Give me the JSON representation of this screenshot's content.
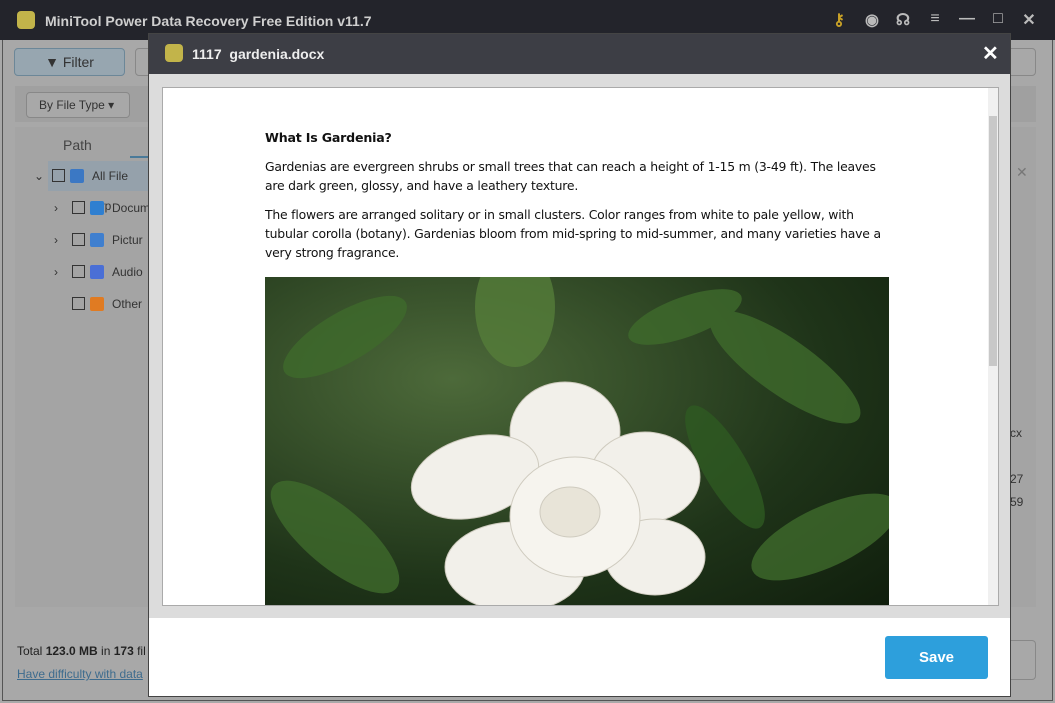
{
  "window": {
    "title": "MiniTool Power Data Recovery Free Edition v11.7",
    "icons": [
      "key-icon",
      "disc-icon",
      "headset-icon",
      "menu-icon",
      "minimize-icon",
      "maximize-icon",
      "close-icon"
    ]
  },
  "toolbar": {
    "filter_label": "Filter",
    "by_file_type": "By File Type"
  },
  "tree": {
    "header": "Path",
    "items": [
      {
        "label": "All File Typ",
        "color": "#3b78c4"
      },
      {
        "label": "Docum",
        "color": "#2f7fd0"
      },
      {
        "label": "Pictur",
        "color": "#3f7fcf"
      },
      {
        "label": "Audio",
        "color": "#4a6fd6"
      },
      {
        "label": "Other",
        "color": "#e07b22"
      }
    ]
  },
  "right_fragments": [
    "cx",
    "27",
    "59"
  ],
  "footer": {
    "total_prefix": "Total ",
    "size": "123.0 MB",
    "in": " in ",
    "count": "173",
    "suffix": " fil",
    "help_link": "Have difficulty with data"
  },
  "preview": {
    "number": "1117",
    "filename": "gardenia.docx",
    "save_label": "Save",
    "heading": "What Is Gardenia?",
    "paragraphs": [
      "Gardenias are evergreen shrubs or small trees that can reach a height of 1-15 m (3-49 ft). The leaves are dark green, glossy, and have a leathery texture.",
      "The flowers are arranged solitary or in small clusters. Color ranges from white to pale yellow, with tubular corolla (botany). Gardenias bloom from mid-spring to mid-summer, and many varieties have a very strong fragrance."
    ]
  },
  "colors": {
    "accent": "#2d9fdc",
    "titlebar": "#23242b",
    "modal_header": "#3d3e45"
  }
}
